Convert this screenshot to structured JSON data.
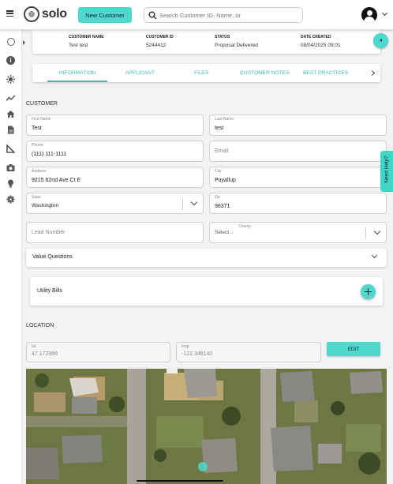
{
  "header": {
    "logo_text": "solo",
    "new_customer_label": "New Customer",
    "search_placeholder": "Search Customer ID, Name, or"
  },
  "summary": {
    "name_label": "CUSTOMER NAME",
    "name_value": "Test test",
    "id_label": "CUSTOMER ID",
    "id_value": "5244412",
    "status_label": "STATUS",
    "status_value": "Proposal Delivered",
    "date_label": "DATE CREATED",
    "date_value": "08/04/2025 09:01"
  },
  "tabs": [
    "INFORMATION",
    "APPLICANT",
    "FILES",
    "CUSTOMER NOTES",
    "BEST PRACTICES"
  ],
  "customer": {
    "section_title": "CUSTOMER",
    "first_name_label": "First Name",
    "first_name": "Test",
    "last_name_label": "Last Name",
    "last_name": "test",
    "phone_label": "Phone",
    "phone": "(111) 111-1111",
    "email_placeholder": "Email",
    "address_label": "Address",
    "address": "9215 62nd Ave Ct E",
    "city_label": "City",
    "city": "Puyallup",
    "state_label": "State",
    "state": "Washington",
    "zip_label": "Zip",
    "zip": "98371",
    "lead_number_placeholder": "Lead Number",
    "county_label": "County",
    "county_placeholder": "Select..."
  },
  "value_questions_label": "Value Questions",
  "utility_bills_label": "Utility Bills",
  "location": {
    "section_title": "LOCATION",
    "lat_label": "lat",
    "lat": "47.172996",
    "long_label": "long",
    "long": "-122.346142",
    "edit_label": "EDIT"
  },
  "need_help_label": "Need Help?",
  "colors": {
    "accent": "#4dd9cd",
    "accent_text": "#3bbab0",
    "help_tab": "#3fd6c6"
  }
}
